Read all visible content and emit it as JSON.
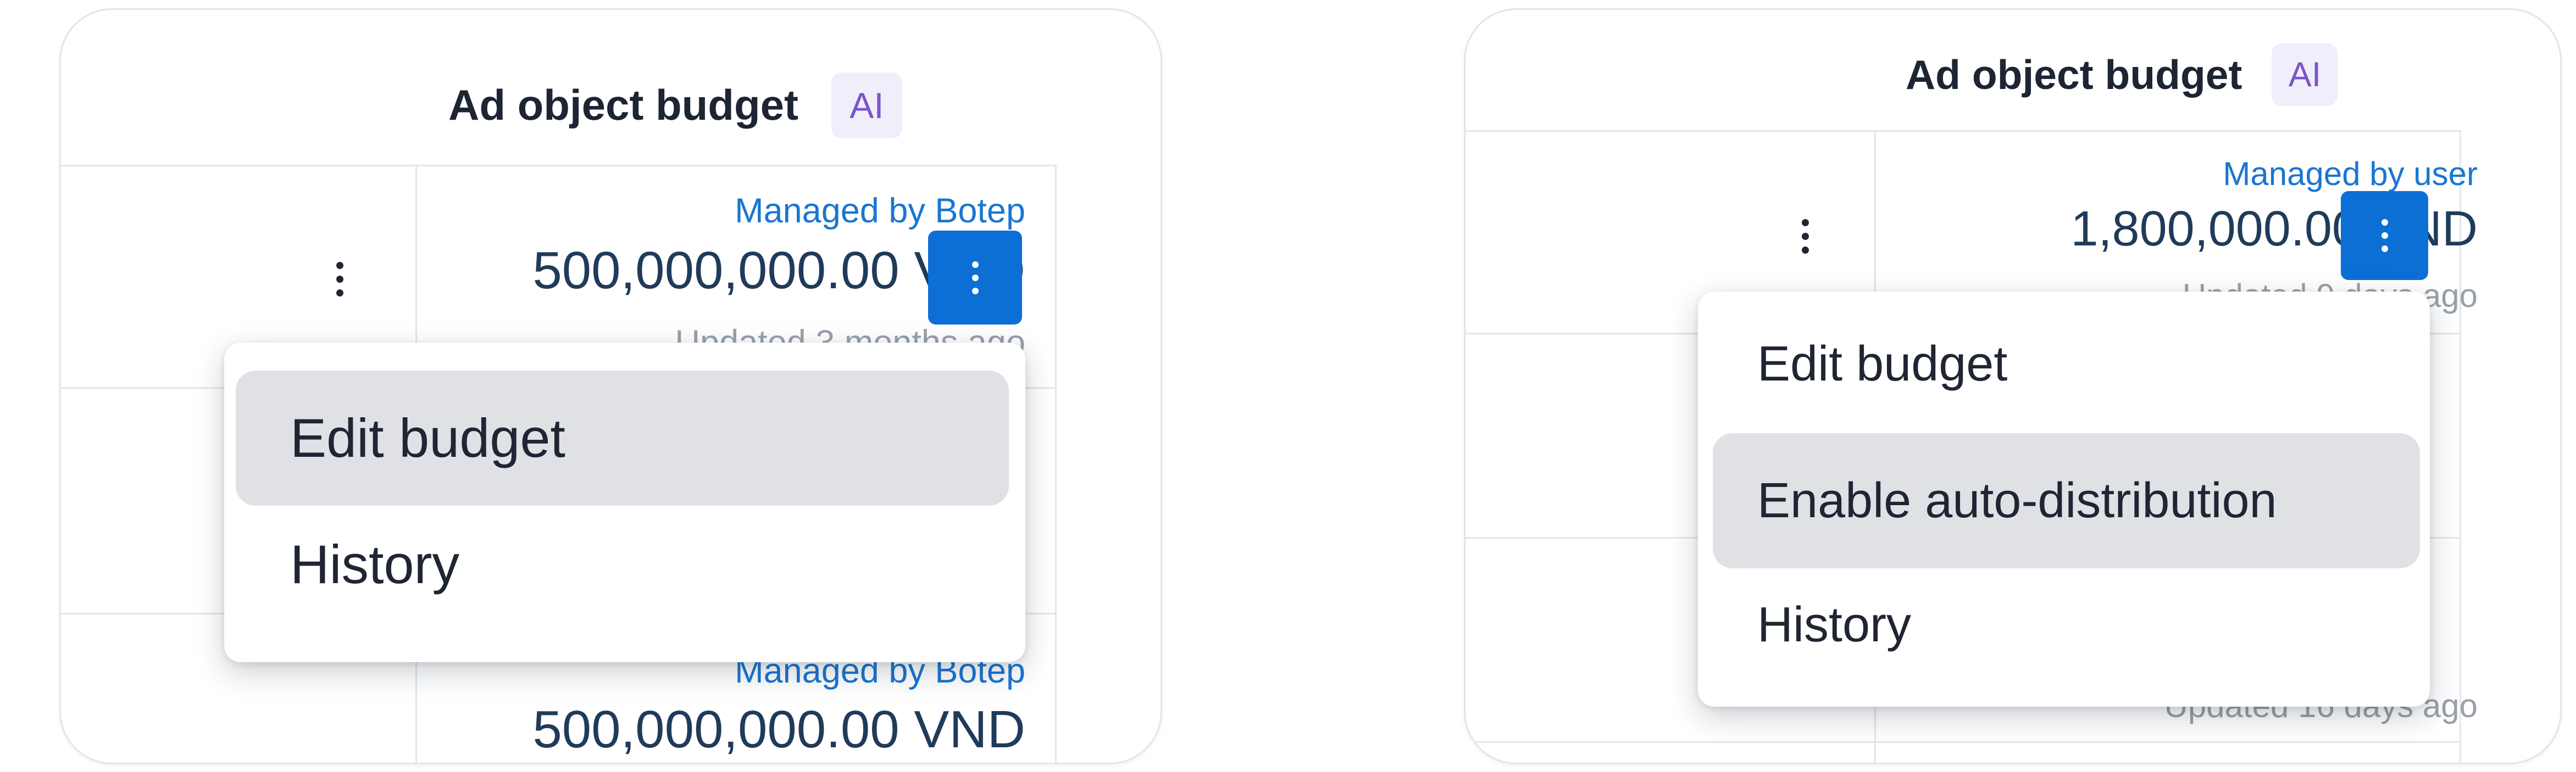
{
  "left_panel": {
    "header": {
      "title": "Ad object budget",
      "ai_badge": "AI"
    },
    "rows": [
      {
        "managed_by": "Managed by Botep",
        "amount": "500,000,000.00 VND",
        "updated": "Updated 3 months ago"
      },
      {
        "managed_by": "Managed by Botep",
        "amount": "500,000,000.00 VND",
        "updated": ""
      }
    ],
    "menu": {
      "items": [
        {
          "label": "Edit budget",
          "highlighted": true
        },
        {
          "label": "History",
          "highlighted": false
        }
      ]
    }
  },
  "right_panel": {
    "header": {
      "title": "Ad object budget",
      "ai_badge": "AI"
    },
    "rows": [
      {
        "managed_by": "Managed by user",
        "amount": "1,800,000.00 VND",
        "updated": "Updated 9 days ago"
      },
      {
        "managed_by": "",
        "amount": "",
        "updated": "Updated 16 days ago"
      }
    ],
    "menu": {
      "items": [
        {
          "label": "Edit budget",
          "highlighted": false
        },
        {
          "label": "Enable auto-distribution",
          "highlighted": true
        },
        {
          "label": "History",
          "highlighted": false
        }
      ]
    }
  },
  "icons": {
    "row_actions": "more-vertical-icon"
  },
  "colors": {
    "link_blue": "#1976d2",
    "amount_text": "#203b5a",
    "active_button": "#0b6fd6",
    "ai_badge_bg": "#f1eefb",
    "ai_badge_text": "#7b55c8",
    "menu_highlight": "#dfe1e5"
  }
}
